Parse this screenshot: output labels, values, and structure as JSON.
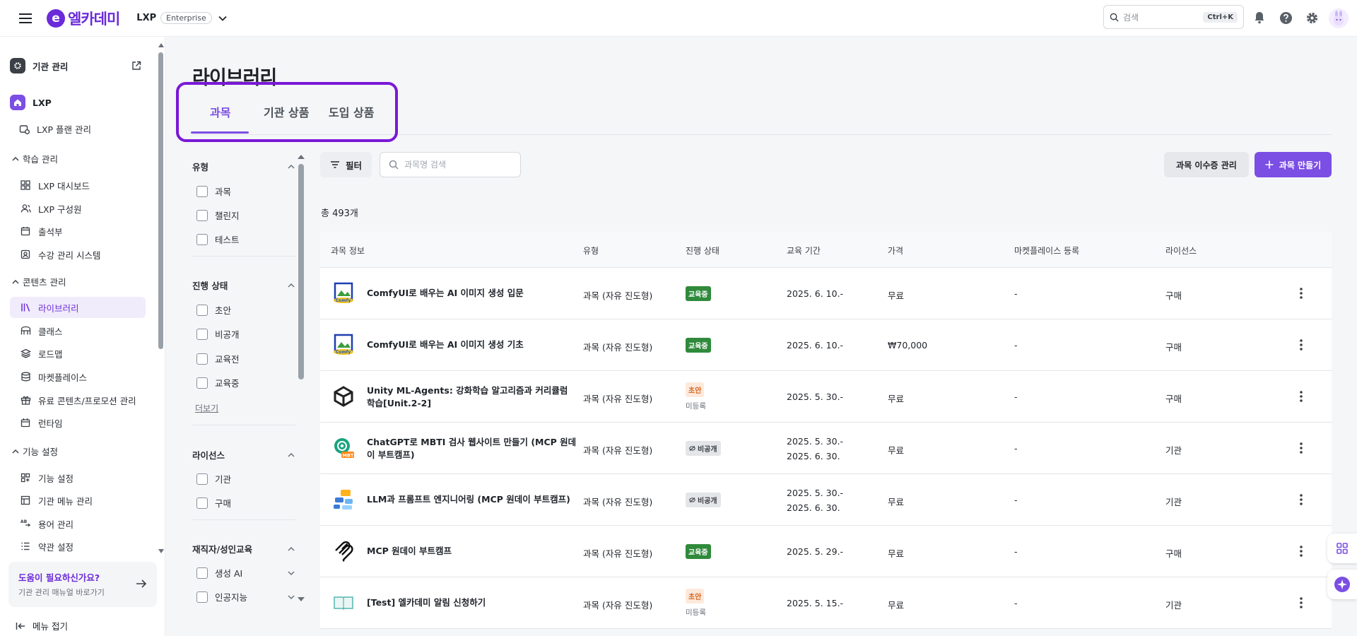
{
  "header": {
    "logo_text": "엘카데미",
    "product": "LXP",
    "edition_badge": "Enterprise",
    "search_placeholder": "검색",
    "search_shortcut": "Ctrl+K"
  },
  "sidebar": {
    "org_admin": "기관 관리",
    "lxp": "LXP",
    "items_top": [
      {
        "label": "LXP 플랜 관리",
        "icon": "plan-icon"
      }
    ],
    "sections": [
      {
        "label": "학습 관리",
        "items": [
          {
            "label": "LXP 대시보드",
            "icon": "dashboard-icon"
          },
          {
            "label": "LXP 구성원",
            "icon": "members-icon"
          },
          {
            "label": "출석부",
            "icon": "calendar-icon"
          },
          {
            "label": "수강 관리 시스템",
            "icon": "enrollment-icon"
          }
        ]
      },
      {
        "label": "콘텐츠 관리",
        "items": [
          {
            "label": "라이브러리",
            "icon": "library-icon",
            "active": true
          },
          {
            "label": "클래스",
            "icon": "class-icon"
          },
          {
            "label": "로드맵",
            "icon": "roadmap-icon"
          },
          {
            "label": "마켓플레이스",
            "icon": "marketplace-icon"
          },
          {
            "label": "유료 콘텐츠/프로모션 관리",
            "icon": "gift-icon"
          },
          {
            "label": "런타임",
            "icon": "runtime-icon"
          }
        ]
      },
      {
        "label": "기능 설정",
        "items": [
          {
            "label": "기능 설정",
            "icon": "feature-icon"
          },
          {
            "label": "기관 메뉴 관리",
            "icon": "menu-icon"
          },
          {
            "label": "용어 관리",
            "icon": "terms-icon"
          },
          {
            "label": "약관 설정",
            "icon": "policy-icon"
          }
        ]
      }
    ],
    "help_title": "도움이 필요하신가요?",
    "help_sub": "기관 관리 매뉴얼 바로가기",
    "collapse_label": "메뉴 접기"
  },
  "page": {
    "title": "라이브러리",
    "tabs": [
      "과목",
      "기관 상품",
      "도입 상품"
    ],
    "active_tab": 0
  },
  "filters": {
    "groups": [
      {
        "title": "유형",
        "options": [
          "과목",
          "챌린지",
          "테스트"
        ]
      },
      {
        "title": "진행 상태",
        "options": [
          "초안",
          "비공개",
          "교육전",
          "교육중"
        ],
        "more": "더보기"
      },
      {
        "title": "라이선스",
        "options": [
          "기관",
          "구매"
        ]
      },
      {
        "title": "재직자/성인교육",
        "options": [
          "생성 AI",
          "인공지능"
        ]
      }
    ]
  },
  "toolbar": {
    "filter_label": "필터",
    "search_placeholder": "과목명 검색",
    "completion_button": "과목 이수증 관리",
    "create_button": "과목 만들기",
    "total": "총 493개"
  },
  "table": {
    "headers": [
      "과목 정보",
      "유형",
      "진행 상태",
      "교육 기간",
      "가격",
      "마켓플레이스 등록",
      "라이선스"
    ],
    "rows": [
      {
        "name": "ComfyUI로 배우는 AI 이미지 생성 입문",
        "type": "과목 (자유 진도형)",
        "status": "교육중",
        "status_kind": "green",
        "period": [
          "2025. 6. 10.-"
        ],
        "price": "무료",
        "market": "-",
        "license": "구매",
        "thumb": "comfyui-thumb"
      },
      {
        "name": "ComfyUI로 배우는 AI 이미지 생성 기초",
        "type": "과목 (자유 진도형)",
        "status": "교육중",
        "status_kind": "green",
        "period": [
          "2025. 6. 10.-"
        ],
        "price": "₩70,000",
        "market": "-",
        "license": "구매",
        "thumb": "comfyui-thumb"
      },
      {
        "name": "Unity ML-Agents: 강화학습 알고리즘과 커리큘럼 학습[Unit.2-2]",
        "type": "과목 (자유 진도형)",
        "status": "초안",
        "status_kind": "draft",
        "sub_status": "미등록",
        "period": [
          "2025. 5. 30.-"
        ],
        "price": "무료",
        "market": "-",
        "license": "구매",
        "thumb": "unity-thumb"
      },
      {
        "name": "ChatGPT로 MBTI 검사 웹사이트 만들기 (MCP 원데이 부트캠프)",
        "type": "과목 (자유 진도형)",
        "status": "비공개",
        "status_kind": "private",
        "period": [
          "2025. 5. 30.-",
          "2025. 6. 30."
        ],
        "price": "무료",
        "market": "-",
        "license": "기관",
        "thumb": "chatgpt-thumb"
      },
      {
        "name": "LLM과 프롬프트 엔지니어링 (MCP 원데이 부트캠프)",
        "type": "과목 (자유 진도형)",
        "status": "비공개",
        "status_kind": "private",
        "period": [
          "2025. 5. 30.-",
          "2025. 6. 30."
        ],
        "price": "무료",
        "market": "-",
        "license": "기관",
        "thumb": "llm-thumb"
      },
      {
        "name": "MCP 원데이 부트캠프",
        "type": "과목 (자유 진도형)",
        "status": "교육중",
        "status_kind": "green",
        "period": [
          "2025. 5. 29.-"
        ],
        "price": "무료",
        "market": "-",
        "license": "구매",
        "thumb": "mcp-thumb"
      },
      {
        "name": "[Test] 엘카데미 알림 신청하기",
        "type": "과목 (자유 진도형)",
        "status": "초안",
        "status_kind": "draft",
        "sub_status": "미등록",
        "period": [
          "2025. 5. 15.-"
        ],
        "price": "무료",
        "market": "-",
        "license": "기관",
        "thumb": "book-thumb"
      }
    ]
  },
  "colors": {
    "brand": "#6b2bd9",
    "accent": "#7b4ee4",
    "green": "#2f8a3b",
    "highlight": "#7a18d6"
  }
}
